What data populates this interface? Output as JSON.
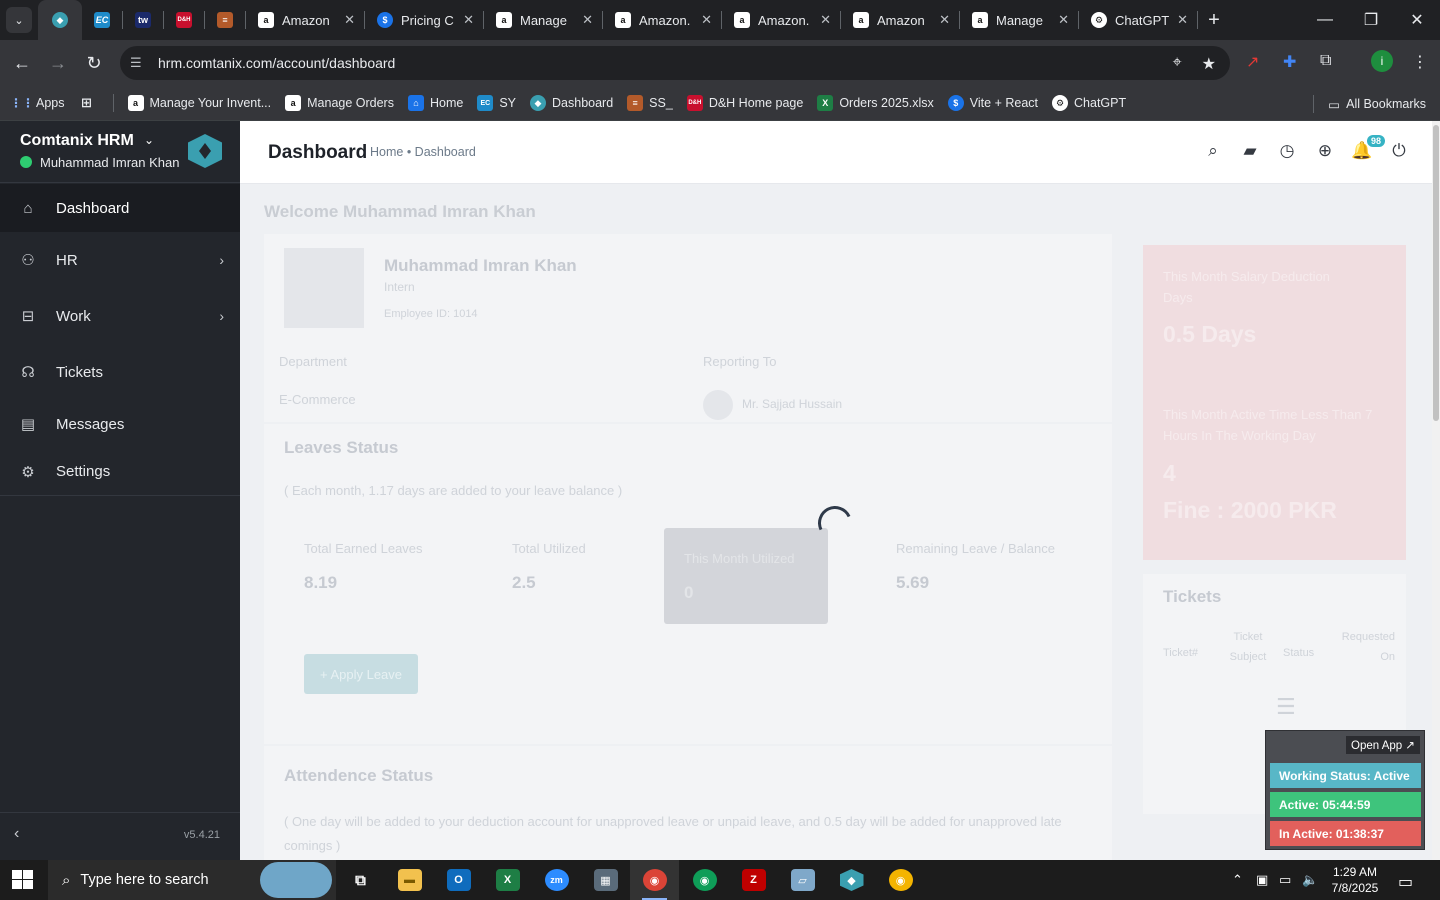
{
  "browser": {
    "tabs": [
      {
        "title": "Amazon",
        "icon": "amazon-icon"
      },
      {
        "title": "Pricing C",
        "icon": "dollar-icon"
      },
      {
        "title": "Manage",
        "icon": "amazon-icon"
      },
      {
        "title": "Amazon.",
        "icon": "amazon-icon"
      },
      {
        "title": "Amazon.",
        "icon": "amazon-icon"
      },
      {
        "title": "Amazon",
        "icon": "amazon-icon"
      },
      {
        "title": "Manage",
        "icon": "amazon-icon"
      },
      {
        "title": "ChatGPT",
        "icon": "chatgpt-icon"
      }
    ],
    "pinned": {
      "ec": "EC",
      "tw": "tw",
      "dh": "D&H"
    },
    "url": "hrm.comtanix.com/account/dashboard",
    "bookmarks": [
      {
        "label": "Apps"
      },
      {
        "label": "Manage Your Invent..."
      },
      {
        "label": "Manage Orders"
      },
      {
        "label": "Home"
      },
      {
        "label": "SY"
      },
      {
        "label": "Dashboard"
      },
      {
        "label": "SS_"
      },
      {
        "label": "D&H Home page"
      },
      {
        "label": "Orders 2025.xlsx"
      },
      {
        "label": "Vite + React"
      },
      {
        "label": "ChatGPT"
      }
    ],
    "all_bookmarks": "All Bookmarks",
    "profile_initial": "i"
  },
  "sidebar": {
    "brand": "Comtanix HRM",
    "user": "Muhammad Imran Khan",
    "items": [
      {
        "label": "Dashboard"
      },
      {
        "label": "HR"
      },
      {
        "label": "Work"
      },
      {
        "label": "Tickets"
      },
      {
        "label": "Messages"
      },
      {
        "label": "Settings"
      }
    ],
    "version": "v5.4.21"
  },
  "header": {
    "title": "Dashboard",
    "breadcrumb": "Home • Dashboard",
    "notification_count": "98"
  },
  "main": {
    "welcome": "Welcome Muhammad Imran Khan",
    "profile": {
      "name": "Muhammad Imran Khan",
      "role": "Intern",
      "employee_id": "Employee ID: 1014",
      "department_label": "Department",
      "department": "E-Commerce",
      "reporting_label": "Reporting To",
      "reporting_to": "Mr. Sajjad Hussain"
    },
    "leaves": {
      "title": "Leaves Status",
      "note": "( Each month, 1.17 days are added to your leave balance )",
      "tiles": [
        {
          "label": "Total Earned Leaves",
          "value": "8.19"
        },
        {
          "label": "Total Utilized",
          "value": "2.5"
        },
        {
          "label": "This Month Utilized",
          "value": "0"
        },
        {
          "label": "Remaining Leave / Balance",
          "value": "5.69"
        }
      ],
      "apply_label": "+ Apply Leave"
    },
    "attendance": {
      "title": "Attendence Status",
      "note": "( One day will be added to your deduction account for unapproved leave or unpaid leave, and 0.5 day will be added for unapproved late comings )"
    },
    "salary": {
      "deduction_label": "This Month Salary Deduction Days",
      "deduction_value": "0.5 Days",
      "active_label": "This Month Active Time Less Than 7 Hours In The Working Day",
      "active_value": "4",
      "fine": "Fine : 2000 PKR"
    },
    "tickets": {
      "title": "Tickets",
      "columns": [
        "Ticket#",
        "Ticket Subject",
        "Status",
        "Requested On"
      ]
    }
  },
  "widget": {
    "open_app": "Open App ↗",
    "status": "Working Status: Active",
    "active": "Active: 05:44:59",
    "inactive": "In Active: 01:38:37"
  },
  "taskbar": {
    "search_placeholder": "Type here to search",
    "time": "1:29 AM",
    "date": "7/8/2025"
  },
  "colors": {
    "sidebar": "#23262c",
    "accent": "#36b3c4",
    "active_green": "#3ec47c",
    "inactive_red": "#e2605c"
  }
}
